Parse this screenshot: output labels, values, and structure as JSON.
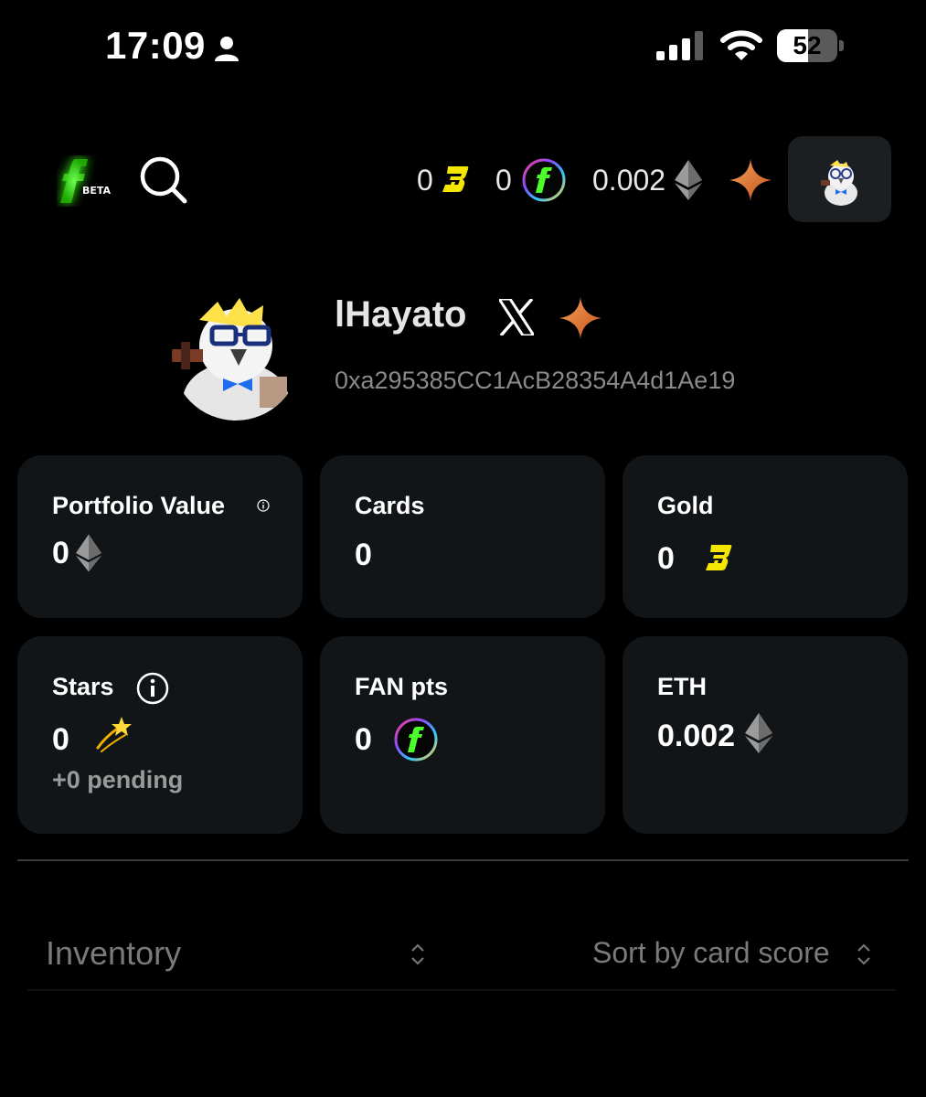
{
  "status_bar": {
    "time": "17:09",
    "battery": "52",
    "battery_level": 0.52,
    "icons": [
      "person-icon",
      "signal-icon",
      "wifi-icon",
      "battery-icon"
    ]
  },
  "header": {
    "logo_badge": "BETA",
    "balances": {
      "gold": "0",
      "fan": "0",
      "eth": "0.002"
    },
    "icons": [
      "logo-icon",
      "search-icon",
      "gold-coin-icon",
      "fan-coin-icon",
      "eth-icon",
      "star-icon",
      "avatar"
    ]
  },
  "profile": {
    "username": "lHayato",
    "address": "0xa295385CC1AcB28354A4d1Ae19"
  },
  "stats": {
    "portfolio": {
      "label": "Portfolio Value",
      "value": "0"
    },
    "cards": {
      "label": "Cards",
      "value": "0"
    },
    "gold": {
      "label": "Gold",
      "value": "0"
    },
    "stars": {
      "label": "Stars",
      "value": "0",
      "pending": "+0 pending"
    },
    "fan": {
      "label": "FAN pts",
      "value": "0"
    },
    "eth": {
      "label": "ETH",
      "value": "0.002"
    }
  },
  "inventory": {
    "label": "Inventory",
    "sort_label": "Sort by card score"
  },
  "colors": {
    "background": "#000000",
    "card": "#111517",
    "gold_accent": "#f5e600",
    "logo_green": "#39ff14",
    "star_orange": "#e8722a"
  }
}
